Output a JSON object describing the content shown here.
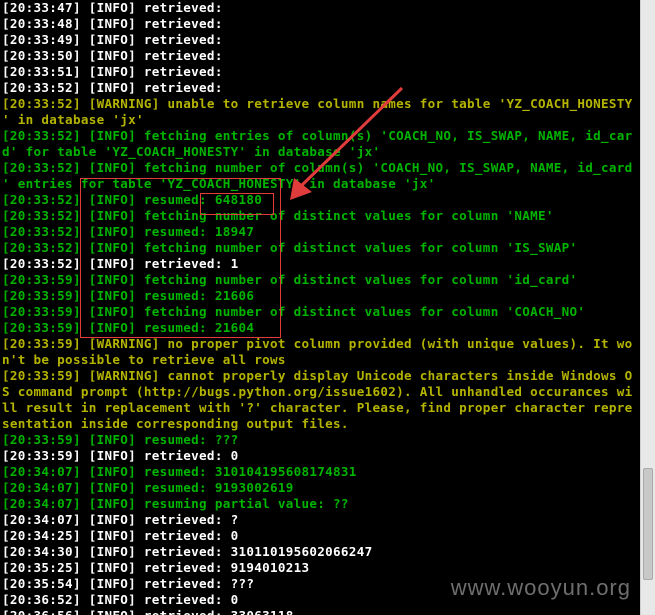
{
  "lines": [
    {
      "text": "[20:33:47] [INFO] retrieved:",
      "color": "white"
    },
    {
      "text": "[20:33:48] [INFO] retrieved:",
      "color": "white"
    },
    {
      "text": "[20:33:49] [INFO] retrieved:",
      "color": "white"
    },
    {
      "text": "[20:33:50] [INFO] retrieved:",
      "color": "white"
    },
    {
      "text": "[20:33:51] [INFO] retrieved:",
      "color": "white"
    },
    {
      "text": "[20:33:52] [INFO] retrieved:",
      "color": "white"
    },
    {
      "text": "[20:33:52] [WARNING] unable to retrieve column names for table 'YZ_COACH_HONESTY",
      "color": "yellow"
    },
    {
      "text": "' in database 'jx'",
      "color": "yellow"
    },
    {
      "text": "[20:33:52] [INFO] fetching entries of column(s) 'COACH_NO, IS_SWAP, NAME, id_car",
      "color": "green"
    },
    {
      "text": "d' for table 'YZ_COACH_HONESTY' in database 'jx'",
      "color": "green"
    },
    {
      "text": "[20:33:52] [INFO] fetching number of column(s) 'COACH_NO, IS_SWAP, NAME, id_card",
      "color": "green"
    },
    {
      "text": "' entries for table 'YZ_COACH_HONESTY' in database 'jx'",
      "color": "green"
    },
    {
      "text": "[20:33:52] [INFO] resumed: 648180",
      "color": "green"
    },
    {
      "text": "[20:33:52] [INFO] fetching number of distinct values for column 'NAME'",
      "color": "green"
    },
    {
      "text": "[20:33:52] [INFO] resumed: 18947",
      "color": "green"
    },
    {
      "text": "[20:33:52] [INFO] fetching number of distinct values for column 'IS_SWAP'",
      "color": "green"
    },
    {
      "text": "[20:33:52] [INFO] retrieved: 1",
      "color": "white"
    },
    {
      "text": "[20:33:59] [INFO] fetching number of distinct values for column 'id_card'",
      "color": "green"
    },
    {
      "text": "[20:33:59] [INFO] resumed: 21606",
      "color": "green"
    },
    {
      "text": "[20:33:59] [INFO] fetching number of distinct values for column 'COACH_NO'",
      "color": "green"
    },
    {
      "text": "[20:33:59] [INFO] resumed: 21604",
      "color": "green"
    },
    {
      "text": "[20:33:59] [WARNING] no proper pivot column provided (with unique values). It wo",
      "color": "yellow"
    },
    {
      "text": "n't be possible to retrieve all rows",
      "color": "yellow"
    },
    {
      "text": "[20:33:59] [WARNING] cannot properly display Unicode characters inside Windows O",
      "color": "yellow"
    },
    {
      "text": "S command prompt (http://bugs.python.org/issue1602). All unhandled occurances wi",
      "color": "yellow"
    },
    {
      "text": "ll result in replacement with '?' character. Please, find proper character repre",
      "color": "yellow"
    },
    {
      "text": "sentation inside corresponding output files.",
      "color": "yellow"
    },
    {
      "text": "[20:33:59] [INFO] resumed: ???",
      "color": "green"
    },
    {
      "text": "[20:33:59] [INFO] retrieved: 0",
      "color": "white"
    },
    {
      "text": "[20:34:07] [INFO] resumed: 310104195608174831",
      "color": "green"
    },
    {
      "text": "[20:34:07] [INFO] resumed: 9193002619",
      "color": "green"
    },
    {
      "text": "[20:34:07] [INFO] resuming partial value: ??",
      "color": "green"
    },
    {
      "text": "[20:34:07] [INFO] retrieved: ?",
      "color": "white"
    },
    {
      "text": "[20:34:25] [INFO] retrieved: 0",
      "color": "white"
    },
    {
      "text": "[20:34:30] [INFO] retrieved: 310110195602066247",
      "color": "white"
    },
    {
      "text": "[20:35:25] [INFO] retrieved: 9194010213",
      "color": "white"
    },
    {
      "text": "[20:35:54] [INFO] retrieved: ???",
      "color": "white"
    },
    {
      "text": "[20:36:52] [INFO] retrieved: 0",
      "color": "white"
    },
    {
      "text": "[20:36:56] [INFO] retrieved: 33063118",
      "color": "white"
    }
  ],
  "colors": {
    "white": "#ffffff",
    "green": "#00b400",
    "yellow": "#b4b400",
    "annotation": "#e03c3c"
  },
  "watermark": "www.wooyun.org"
}
